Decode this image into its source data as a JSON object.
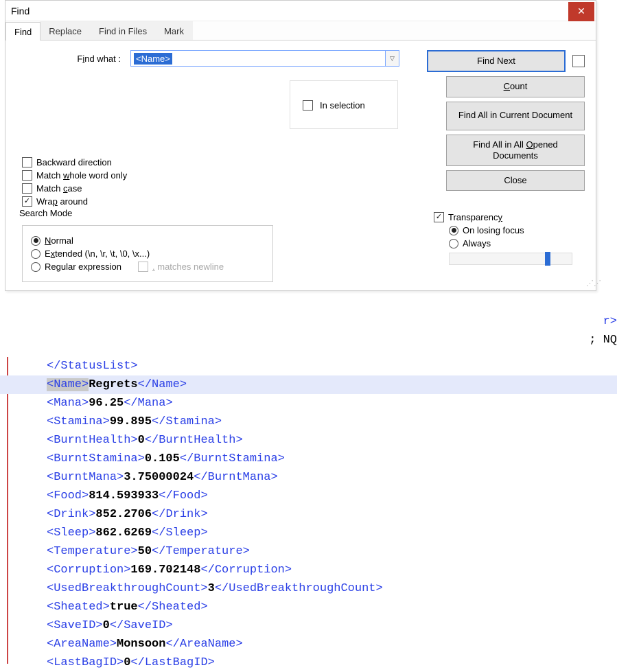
{
  "dialog": {
    "title": "Find",
    "tabs": {
      "find": "Find",
      "replace": "Replace",
      "findInFiles": "Find in Files",
      "mark": "Mark"
    },
    "findLabelPrefix": "F",
    "findLabelAccel": "i",
    "findLabelSuffix": "nd what :",
    "findValue": "<Name>",
    "inSelection": "In selection",
    "backward": "Backward direction",
    "wholeWordPrefix": "Match ",
    "wholeWordAccel": "w",
    "wholeWordSuffix": "hole word only",
    "matchCasePrefix": "Match ",
    "matchCaseAccel": "c",
    "matchCaseSuffix": "ase",
    "wrapAroundPrefix": "Wra",
    "wrapAroundAccel": "p",
    "wrapAroundSuffix": " around",
    "searchModeLabel": "Search Mode",
    "modeNormalAccel": "N",
    "modeNormalSuffix": "ormal",
    "modeExtendedPrefix": "E",
    "modeExtendedAccel": "x",
    "modeExtendedSuffix": "tended (\\n, \\r, \\t, \\0, \\x...)",
    "modeRegex": "Regular expression",
    "matchesNewlinePrefix": "",
    "matchesNewlineAccel": ".",
    "matchesNewlineSuffix": " matches newline",
    "transparencyPrefix": "Transparenc",
    "transparencyAccel": "y",
    "onLosingFocus": "On losing focus",
    "always": "Always",
    "buttons": {
      "findNext": "Find Next",
      "count": "Count",
      "findAllCurrent": "Find All in Current Document",
      "findAllOpenedPrefix": "Find All in All ",
      "findAllOpenedAccel": "O",
      "findAllOpenedSuffix": "pened Documents",
      "close": "Close"
    },
    "checked": {
      "wrapAround": true,
      "transparency": true,
      "onLosingFocus": true,
      "modeNormal": true
    }
  },
  "bg": {
    "l1": "r>",
    "l2": "; NQ"
  },
  "code": [
    {
      "open": "</StatusList>",
      "val": ""
    },
    {
      "open": "<Name>",
      "val": "Regrets",
      "close": "</Name>",
      "highlight": true,
      "matchOpen": true
    },
    {
      "open": "<Mana>",
      "val": "96.25",
      "close": "</Mana>"
    },
    {
      "open": "<Stamina>",
      "val": "99.895",
      "close": "</Stamina>"
    },
    {
      "open": "<BurntHealth>",
      "val": "0",
      "close": "</BurntHealth>"
    },
    {
      "open": "<BurntStamina>",
      "val": "0.105",
      "close": "</BurntStamina>"
    },
    {
      "open": "<BurntMana>",
      "val": "3.75000024",
      "close": "</BurntMana>"
    },
    {
      "open": "<Food>",
      "val": "814.593933",
      "close": "</Food>"
    },
    {
      "open": "<Drink>",
      "val": "852.2706",
      "close": "</Drink>"
    },
    {
      "open": "<Sleep>",
      "val": "862.6269",
      "close": "</Sleep>"
    },
    {
      "open": "<Temperature>",
      "val": "50",
      "close": "</Temperature>"
    },
    {
      "open": "<Corruption>",
      "val": "169.702148",
      "close": "</Corruption>"
    },
    {
      "open": "<UsedBreakthroughCount>",
      "val": "3",
      "close": "</UsedBreakthroughCount>"
    },
    {
      "open": "<Sheated>",
      "val": "true",
      "close": "</Sheated>"
    },
    {
      "open": "<SaveID>",
      "val": "0",
      "close": "</SaveID>"
    },
    {
      "open": "<AreaName>",
      "val": "Monsoon",
      "close": "</AreaName>"
    },
    {
      "open": "<LastBagID>",
      "val": "0",
      "close": "</LastBagID>"
    }
  ]
}
